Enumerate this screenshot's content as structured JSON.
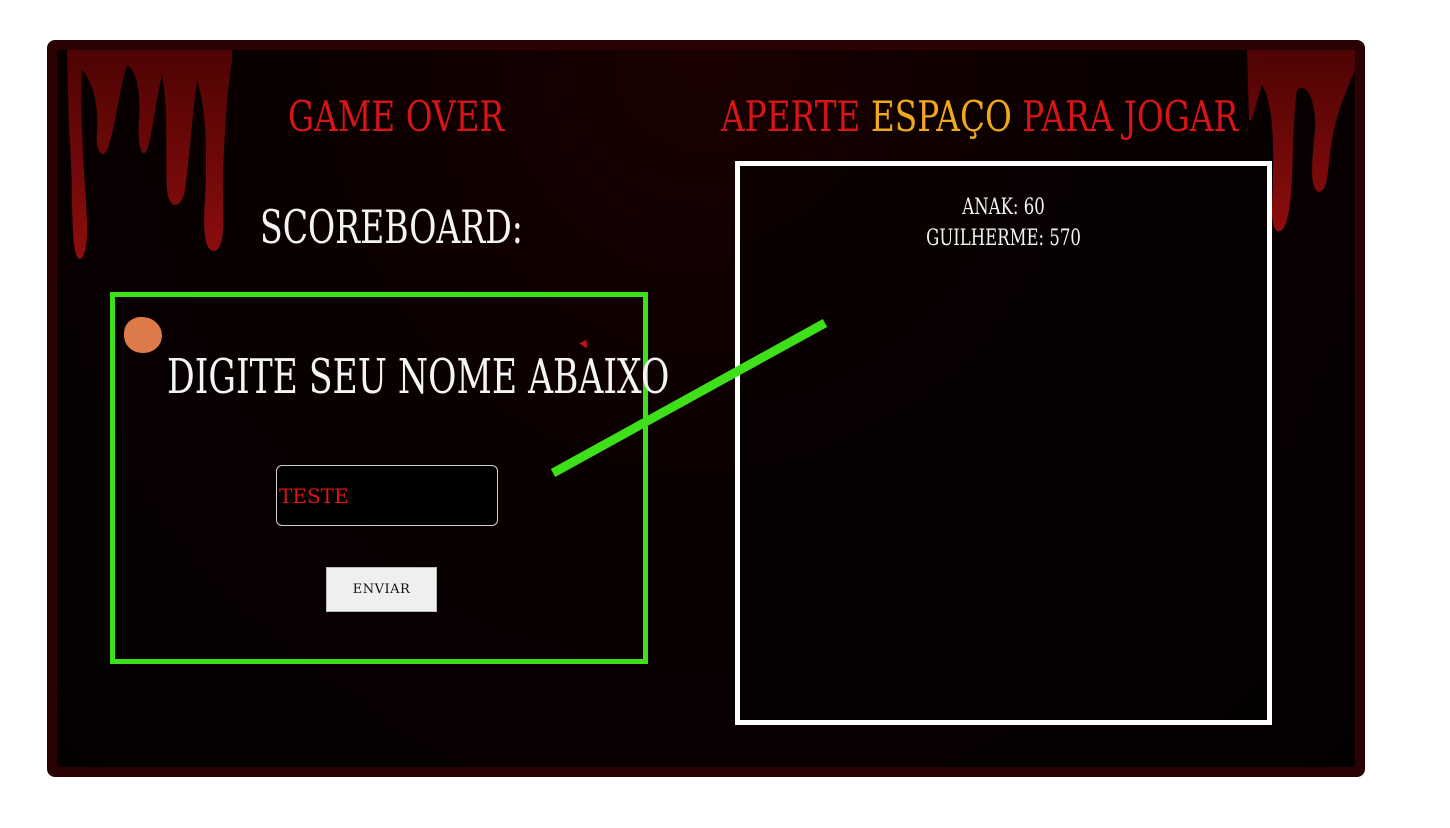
{
  "header": {
    "game_over": "GAME OVER",
    "press_prefix": "APERTE",
    "press_key": "ESPAÇO",
    "press_suffix": "PARA JOGAR"
  },
  "scoreboard": {
    "label": "SCOREBOARD:",
    "entries": [
      {
        "text": "ANAK: 60"
      },
      {
        "text": "GUILHERME: 570"
      }
    ]
  },
  "name_form": {
    "prompt": "DIGITE SEU NOME ABAIXO",
    "input_value": "TESTE",
    "submit_label": "ENVIAR"
  },
  "colors": {
    "accent_red": "#d81414",
    "accent_gold": "#f2a81c",
    "highlight_green": "#3de019",
    "panel_border": "#ffffff",
    "frame": "#2a0202"
  },
  "icons": {
    "blood_drips": "blood-drips-decoration",
    "orange_blob": "orange-blob-icon"
  }
}
